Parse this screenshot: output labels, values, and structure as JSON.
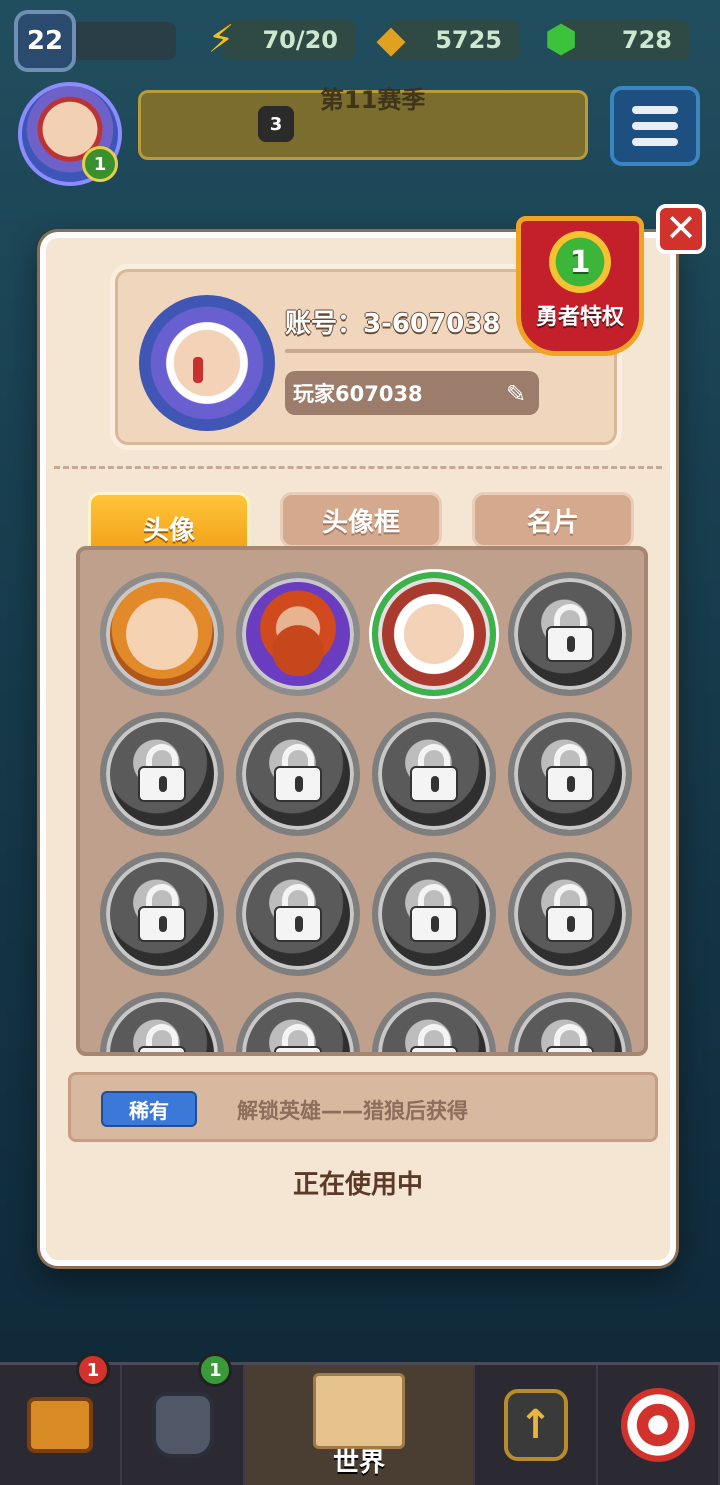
{
  "hud": {
    "level": "22",
    "energy": "70/20",
    "gold": "5725",
    "gems": "728",
    "avatar_badge": "1",
    "season_title": "第11赛季",
    "season_level": "3"
  },
  "modal": {
    "close_symbol": "✕",
    "account_label": "账号：3-607038",
    "player_name": "玩家607038",
    "privilege": {
      "level": "1",
      "label": "勇者特权"
    },
    "tabs": [
      {
        "label": "头像",
        "active": true
      },
      {
        "label": "头像框",
        "active": false
      },
      {
        "label": "名片",
        "active": false
      }
    ],
    "avatars": [
      {
        "state": "unlocked",
        "icon": "hooded-archer-portrait"
      },
      {
        "state": "unlocked",
        "icon": "masked-ninja-portrait"
      },
      {
        "state": "selected",
        "icon": "wolf-hunter-portrait"
      },
      {
        "state": "locked",
        "icon": "lock-icon"
      },
      {
        "state": "locked",
        "icon": "lock-icon"
      },
      {
        "state": "locked",
        "icon": "lock-icon"
      },
      {
        "state": "locked",
        "icon": "lock-icon"
      },
      {
        "state": "locked",
        "icon": "lock-icon"
      },
      {
        "state": "locked",
        "icon": "lock-icon"
      },
      {
        "state": "locked",
        "icon": "lock-icon"
      },
      {
        "state": "locked",
        "icon": "lock-icon"
      },
      {
        "state": "locked",
        "icon": "lock-icon"
      },
      {
        "state": "locked",
        "icon": "lock-icon"
      },
      {
        "state": "locked",
        "icon": "lock-icon"
      },
      {
        "state": "locked",
        "icon": "lock-icon"
      },
      {
        "state": "locked",
        "icon": "lock-icon"
      }
    ],
    "rarity": "稀有",
    "unlock_info": "解锁英雄——猎狼后获得",
    "status": "正在使用中"
  },
  "bottom_nav": {
    "chest_badge": "1",
    "armor_badge": "1",
    "world_label": "世界"
  },
  "colors": {
    "accent_orange": "#f09b12",
    "selected_green": "#3ab44a",
    "rarity_blue": "#3c78d8",
    "close_red": "#d1322b"
  }
}
